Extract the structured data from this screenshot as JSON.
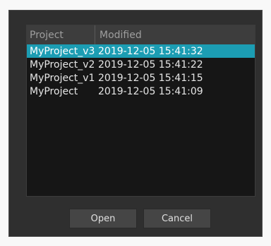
{
  "table": {
    "headers": {
      "project": "Project",
      "modified": "Modified"
    },
    "rows": [
      {
        "project": "MyProject_v3",
        "modified": "2019-12-05 15:41:32",
        "selected": true
      },
      {
        "project": "MyProject_v2",
        "modified": "2019-12-05 15:41:22"
      },
      {
        "project": "MyProject_v1",
        "modified": "2019-12-05 15:41:15"
      },
      {
        "project": "MyProject",
        "modified": "2019-12-05 15:41:09"
      }
    ]
  },
  "buttons": {
    "open": "Open",
    "cancel": "Cancel"
  },
  "colors": {
    "selection": "#1c9db3",
    "dialog_bg": "#2f2f2f",
    "list_bg": "#161616"
  }
}
